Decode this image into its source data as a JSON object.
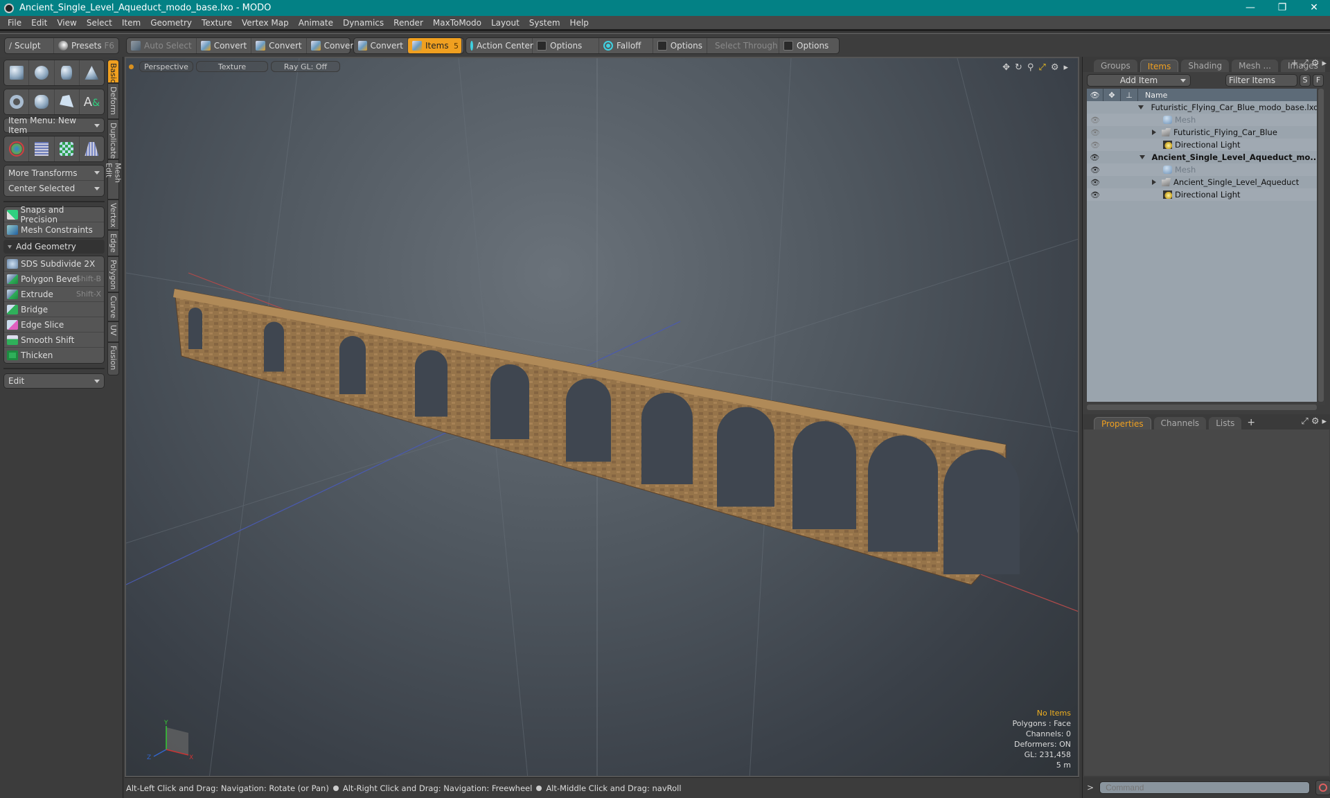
{
  "window": {
    "title": "Ancient_Single_Level_Aqueduct_modo_base.lxo - MODO",
    "controls": [
      "minimize",
      "restore",
      "close"
    ]
  },
  "menu": [
    "File",
    "Edit",
    "View",
    "Select",
    "Item",
    "Geometry",
    "Texture",
    "Vertex Map",
    "Animate",
    "Dynamics",
    "Render",
    "MaxToModo",
    "Layout",
    "System",
    "Help"
  ],
  "toolbar": {
    "sculpt": "Sculpt",
    "presets": "Presets",
    "presets_key": "F6",
    "auto_select": "Auto Select",
    "convert1": "Convert",
    "convert2": "Convert",
    "convert3": "Convert",
    "convert4": "Convert",
    "items": "Items",
    "items_key": "5",
    "action_center": "Action Center",
    "options1": "Options",
    "falloff": "Falloff",
    "options2": "Options",
    "select_through": "Select Through",
    "options3": "Options"
  },
  "left": {
    "item_menu": "Item Menu: New Item",
    "more_transforms": "More Transforms",
    "center_selected": "Center Selected",
    "snaps": "Snaps and Precision",
    "constraints": "Mesh Constraints",
    "add_geometry": "Add Geometry",
    "tools": [
      {
        "label": "SDS Subdivide 2X",
        "shortcut": ""
      },
      {
        "label": "Polygon Bevel",
        "shortcut": "Shift-B"
      },
      {
        "label": "Extrude",
        "shortcut": "Shift-X"
      },
      {
        "label": "Bridge",
        "shortcut": ""
      },
      {
        "label": "Edge Slice",
        "shortcut": ""
      },
      {
        "label": "Smooth Shift",
        "shortcut": ""
      },
      {
        "label": "Thicken",
        "shortcut": ""
      }
    ],
    "edit": "Edit",
    "vtabs": [
      "Basic",
      "Deform",
      "Duplicate",
      "Mesh Edit",
      "Vertex",
      "Edge",
      "Polygon",
      "Curve",
      "UV",
      "Fusion"
    ]
  },
  "viewport": {
    "view": "Perspective",
    "shading": "Texture",
    "raygl": "Ray GL: Off",
    "stats": {
      "selection": "No Items",
      "polygons": "Polygons : Face",
      "channels": "Channels: 0",
      "deformers": "Deformers: ON",
      "gl": "GL: 231,458",
      "scale": "5 m"
    },
    "axes": {
      "x": "X",
      "y": "Y",
      "z": "Z"
    }
  },
  "status": {
    "hint1": "Alt-Left Click and Drag: Navigation: Rotate (or Pan)",
    "hint2": "Alt-Right Click and Drag: Navigation: Freewheel",
    "hint3": "Alt-Middle Click and Drag: navRoll"
  },
  "right": {
    "tabs": [
      "Groups",
      "Items",
      "Shading",
      "Mesh ...",
      "Images"
    ],
    "add_item": "Add Item",
    "filter": "Filter Items",
    "s": "S",
    "f": "F",
    "col_name": "Name",
    "tree": [
      {
        "name": "Futuristic_Flying_Car_Blue_modo_base.lxo*",
        "type": "scene",
        "level": 0,
        "visible": false,
        "eye": false
      },
      {
        "name": "Mesh",
        "type": "mesh",
        "level": 1,
        "dim": true,
        "eye": "dim"
      },
      {
        "name": "Futuristic_Flying_Car_Blue",
        "type": "folder",
        "level": 1,
        "expand": true,
        "eye": "dim"
      },
      {
        "name": "Directional Light",
        "type": "light",
        "level": 1,
        "eye": "dim"
      },
      {
        "name": "Ancient_Single_Level_Aqueduct_mo...",
        "type": "scene",
        "level": 0,
        "bold": true,
        "eye": "on"
      },
      {
        "name": "Mesh",
        "type": "mesh",
        "level": 1,
        "dim": true,
        "eye": "on"
      },
      {
        "name": "Ancient_Single_Level_Aqueduct",
        "type": "folder",
        "level": 1,
        "expand": true,
        "eye": "on"
      },
      {
        "name": "Directional Light",
        "type": "light",
        "level": 1,
        "eye": "on"
      }
    ],
    "prop_tabs": [
      "Properties",
      "Channels",
      "Lists"
    ],
    "command_placeholder": "Command"
  }
}
